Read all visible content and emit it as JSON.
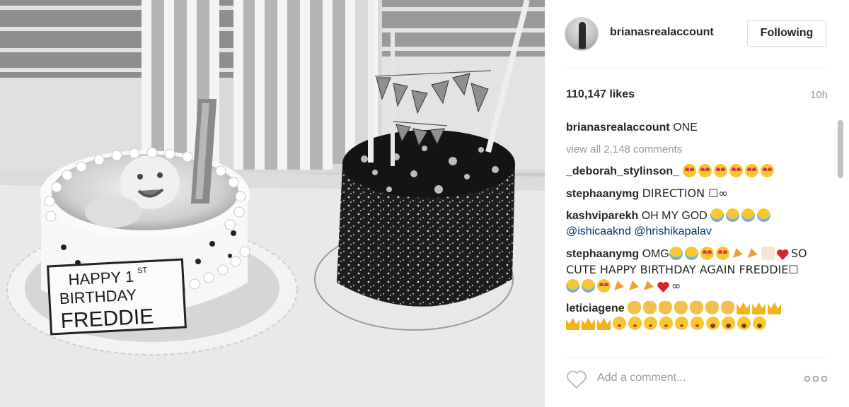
{
  "post": {
    "username": "brianasrealaccount",
    "follow_label": "Following",
    "likes": "110,147 likes",
    "age": "10h",
    "caption_user": "brianasrealaccount",
    "caption_text": "ONE",
    "view_all": "view all 2,148 comments"
  },
  "comments": [
    {
      "user": "_deborah_stylinson_",
      "text": "",
      "emoji": [
        "heart-eyes",
        "heart-eyes",
        "heart-eyes",
        "heart-eyes",
        "heart-eyes",
        "heart-eyes"
      ]
    },
    {
      "user": "stephaanymg",
      "text": "DIRECTION ☐∞"
    },
    {
      "user": "kashviparekh",
      "text": "OH MY GOD",
      "emoji": [
        "cry",
        "cry",
        "cry",
        "cry"
      ],
      "mentions": "@ishicaaknd @hrishikapalav"
    },
    {
      "user": "stephaanymg",
      "text_before": "OMG",
      "text_after": "SO CUTE HAPPY BIRTHDAY AGAIN FREDDIE☐",
      "tail": "∞"
    },
    {
      "user": "leticiagene",
      "text": ""
    }
  ],
  "footer": {
    "add_comment_placeholder": "Add a comment..."
  },
  "photo": {
    "sign_line1": "HAPPY 1",
    "sign_sup": "ST",
    "sign_line2": "BIRTHDAY",
    "sign_line3": "FREDDIE"
  },
  "icons": {
    "like": "heart-outline-icon",
    "more": "more-options-icon"
  },
  "colors": {
    "link": "#003569",
    "muted": "#999999",
    "text": "#262626",
    "border": "#dbdbdb"
  }
}
